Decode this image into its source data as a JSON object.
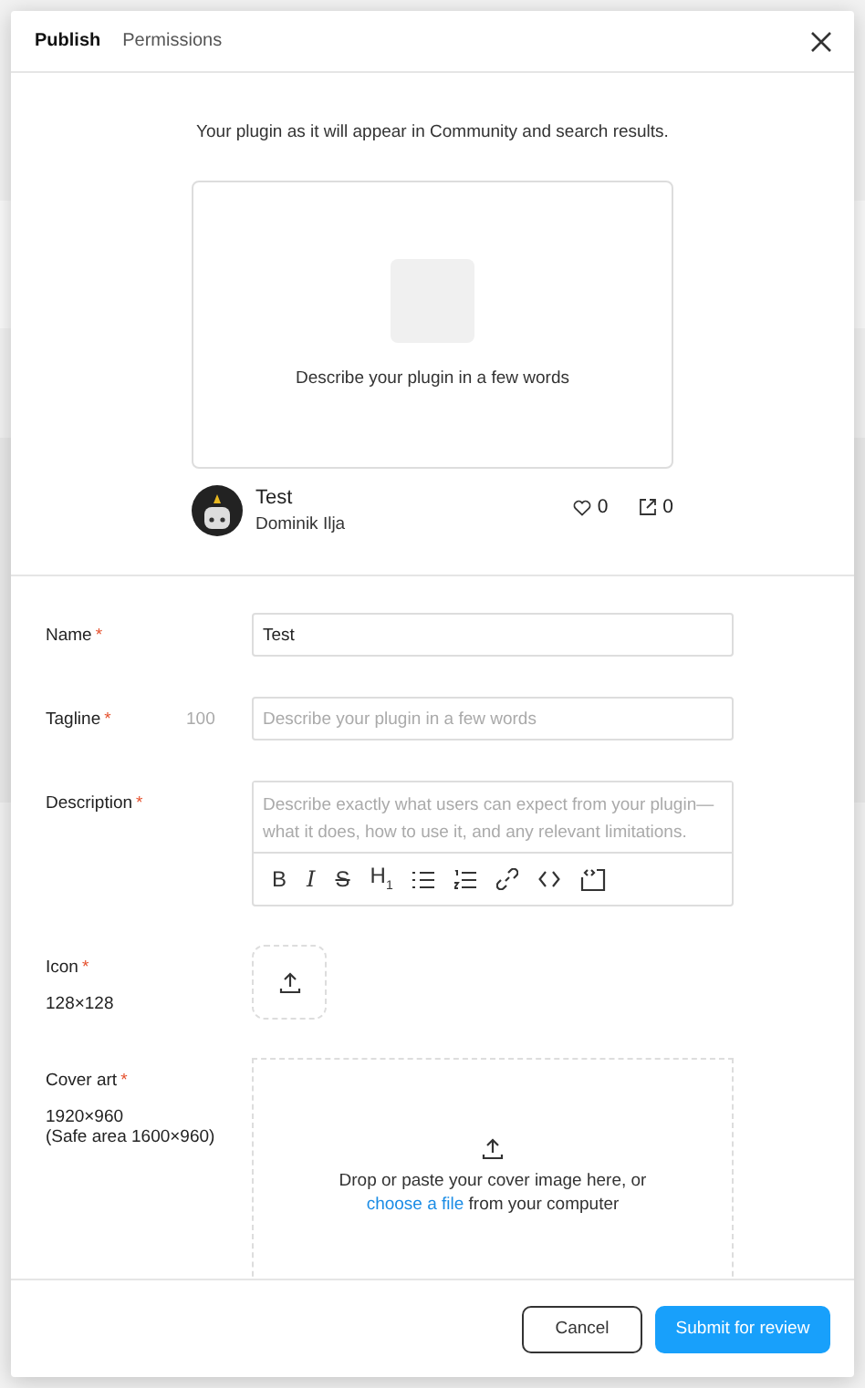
{
  "tabs": [
    {
      "label": "Publish",
      "selected": true
    },
    {
      "label": "Permissions",
      "selected": false
    }
  ],
  "preview": {
    "intro": "Your plugin as it will appear in Community and search results.",
    "card_description": "Describe your plugin in a few words",
    "plugin_name": "Test",
    "author": "Dominik Ilja",
    "likes": "0",
    "shares": "0"
  },
  "fields": [
    {
      "kind": "text",
      "label": "Name",
      "required": true,
      "value": "Test"
    },
    {
      "kind": "text",
      "label": "Tagline",
      "required": true,
      "counter": "100",
      "placeholder": "Describe your plugin in a few words"
    },
    {
      "kind": "rich",
      "label": "Description",
      "required": true,
      "placeholder": "Describe exactly what users can expect from your plugin—what it does, how to use it, and any relevant limitations."
    },
    {
      "kind": "icon",
      "label": "Icon",
      "required": true,
      "hints": [
        "128×128"
      ]
    },
    {
      "kind": "cover",
      "label": "Cover art",
      "required": true,
      "hints": [
        "1920×960",
        "(Safe area 1600×960)"
      ],
      "drop_text": "Drop or paste your cover image here, or",
      "link": "choose a file",
      "after_link": "from your computer"
    }
  ],
  "required_mark": "*",
  "toolbar": [
    {
      "kind": "bold",
      "glyph": "B"
    },
    {
      "kind": "italic",
      "glyph": "I"
    },
    {
      "kind": "strike",
      "glyph": "S"
    },
    {
      "kind": "heading",
      "glyph": "H",
      "sub": "1"
    },
    {
      "kind": "bullets"
    },
    {
      "kind": "numbers"
    },
    {
      "kind": "link"
    },
    {
      "kind": "code"
    },
    {
      "kind": "embed"
    }
  ],
  "buttons": [
    {
      "kind": "secondary",
      "label": "Cancel"
    },
    {
      "kind": "primary",
      "label": "Submit for review"
    }
  ]
}
